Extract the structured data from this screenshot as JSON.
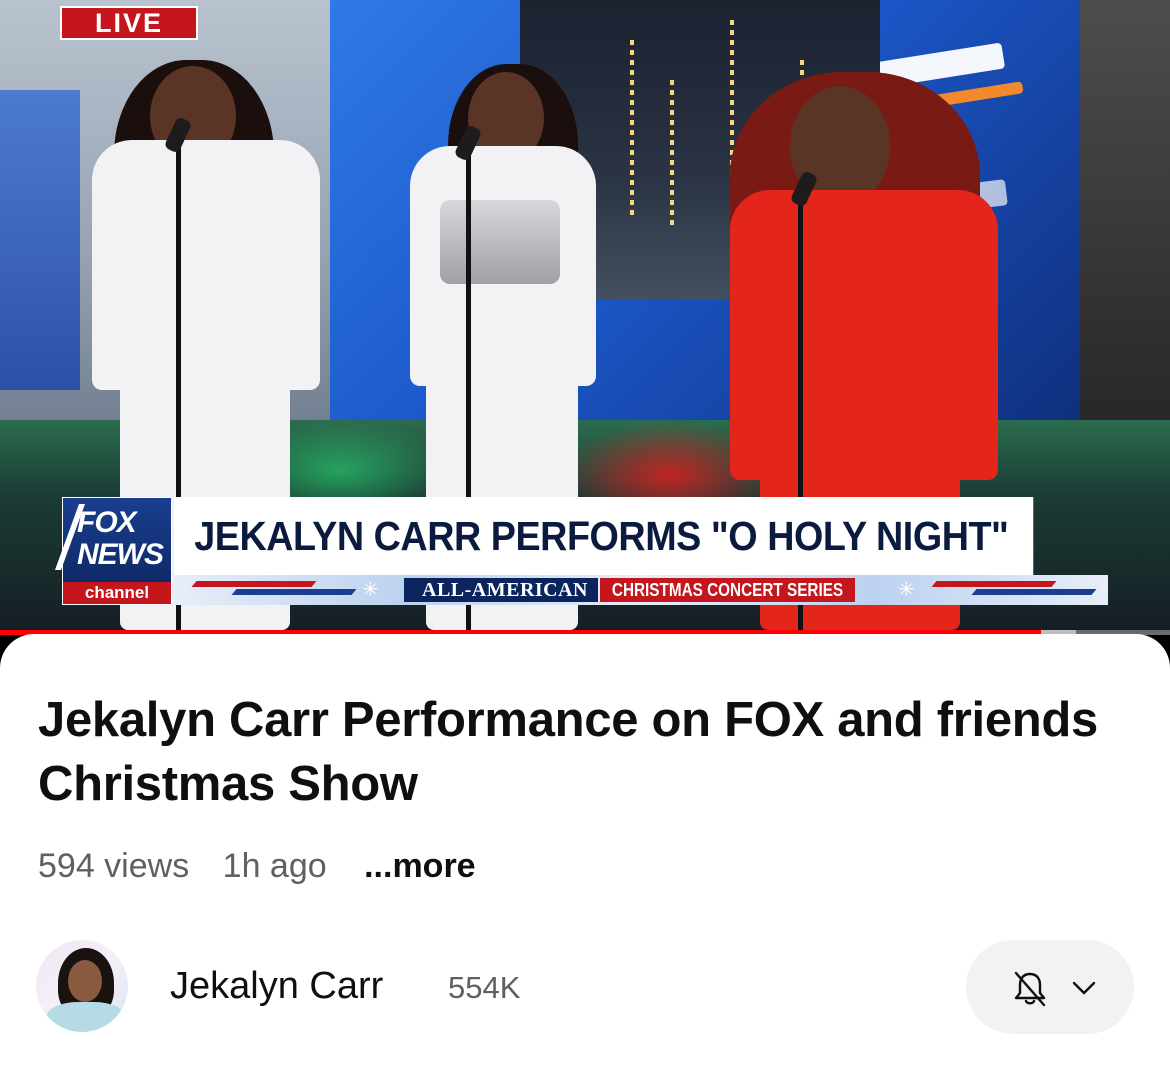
{
  "video": {
    "live_badge": "LIVE",
    "lower_third": {
      "logo_line1": "FOX",
      "logo_line2": "NEWS",
      "logo_line3": "channel",
      "headline": "JEKALYN CARR PERFORMS \"O HOLY NIGHT\"",
      "series_left": "ALL-AMERICAN",
      "series_right": "CHRISTMAS CONCERT SERIES"
    },
    "progress": {
      "played_fraction": 0.89,
      "buffered_fraction": 0.92,
      "played_color": "#ff0000"
    }
  },
  "info": {
    "title": "Jekalyn Carr Performance on FOX and friends Christmas Show",
    "views": "594 views",
    "age": "1h ago",
    "more": "...more"
  },
  "channel": {
    "name": "Jekalyn Carr",
    "subscribers": "554K",
    "avatar_icon": "channel-avatar",
    "subscribe_state_icon": "bell-off-icon",
    "dropdown_icon": "chevron-down-icon"
  }
}
